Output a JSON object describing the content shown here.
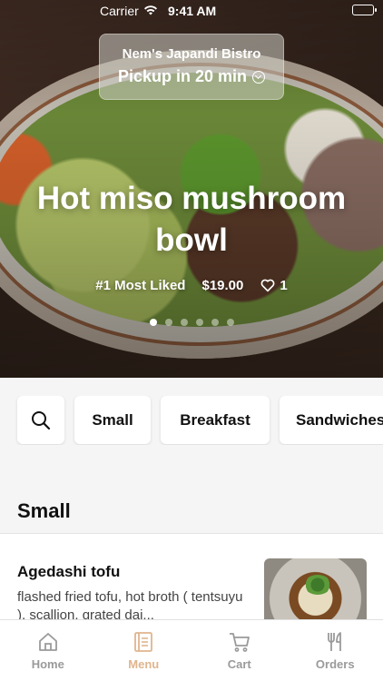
{
  "status_bar": {
    "carrier": "Carrier",
    "time": "9:41 AM"
  },
  "store": {
    "name": "Nem's Japandi Bistro",
    "pickup": "Pickup in 20 min"
  },
  "hero": {
    "title": "Hot miso mushroom bowl",
    "rank": "#1 Most Liked",
    "price": "$19.00",
    "likes": "1",
    "carousel": {
      "total": 6,
      "active_index": 0
    }
  },
  "categories": [
    "Small",
    "Breakfast",
    "Sandwiches"
  ],
  "section": {
    "title": "Small"
  },
  "menu_items": [
    {
      "name": "Agedashi tofu",
      "description": "flashed fried tofu, hot broth ( tentsuyu ), scallion, grated dai..."
    }
  ],
  "tabs": [
    {
      "label": "Home",
      "icon": "home-icon",
      "active": false
    },
    {
      "label": "Menu",
      "icon": "menu-book-icon",
      "active": true
    },
    {
      "label": "Cart",
      "icon": "cart-icon",
      "active": false
    },
    {
      "label": "Orders",
      "icon": "fork-knife-icon",
      "active": false
    }
  ],
  "colors": {
    "accent": "#e0b58e",
    "inactive_tab": "#9a9a9a"
  }
}
